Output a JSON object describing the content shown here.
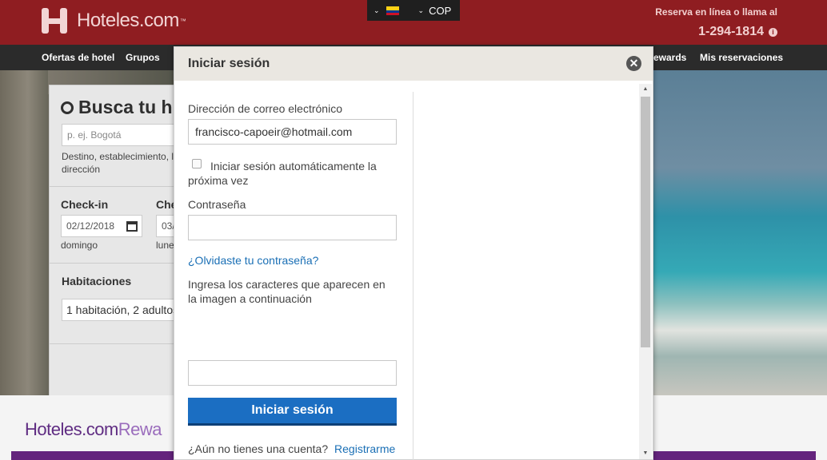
{
  "header": {
    "brand": "Hoteles.com",
    "brand_tm": "™",
    "currency": "COP",
    "phone_label": "Reserva en línea o llama al",
    "phone_number": "1-294-1814",
    "info_icon_glyph": "i"
  },
  "nav": {
    "items": [
      "Ofertas de hotel",
      "Grupos",
      "ewards",
      "Mis reservaciones"
    ]
  },
  "search": {
    "title": "Busca tu h",
    "destination_placeholder": "p. ej. Bogotá",
    "destination_hint_line1": "Destino, establecimiento, l",
    "destination_hint_line2": "dirección",
    "checkin_label": "Check-in",
    "checkin_value": "02/12/2018",
    "checkin_day": "domingo",
    "checkout_label": "Che",
    "checkout_value": "03/",
    "checkout_day": "lune",
    "rooms_label": "Habitaciones",
    "rooms_value": "1 habitación, 2 adultos"
  },
  "rewards": {
    "brand": "Hoteles.com",
    "suffix": "Rewa"
  },
  "modal": {
    "title": "Iniciar sesión",
    "close_glyph": "✕",
    "email_label": "Dirección de correo electrónico",
    "email_value": "francisco-capoeir@hotmail.com",
    "remember_label": "Iniciar sesión automáticamente la próxima vez",
    "password_label": "Contraseña",
    "password_value": "",
    "forgot_link": "¿Olvidaste tu contraseña?",
    "captcha_label": "Ingresa los caracteres que aparecen en la imagen a continuación",
    "captcha_value": "",
    "submit_label": "Iniciar sesión",
    "no_account_text": "¿Aún no tienes una cuenta?",
    "register_link": "Registrarme"
  },
  "colors": {
    "header_bg": "#8f1d21",
    "nav_bg": "#2b2b2b",
    "submit_bg": "#1b6ec2",
    "link": "#1a6fb5",
    "rewards_purple": "#64247d"
  },
  "icons": [
    "hotels-logo-icon",
    "flag-colombia-icon",
    "chevron-down-icon",
    "info-icon",
    "search-icon",
    "calendar-icon",
    "close-icon",
    "scroll-up-arrow-icon",
    "scroll-down-arrow-icon"
  ]
}
